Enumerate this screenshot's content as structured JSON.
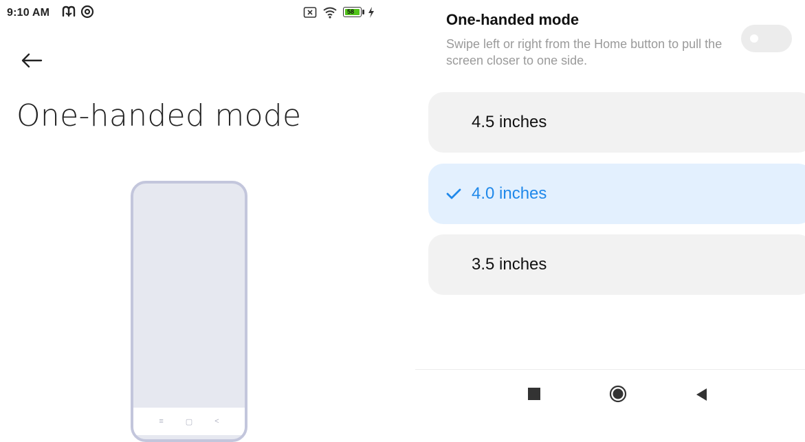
{
  "status_bar": {
    "time": "9:10 AM",
    "app_icons": [
      "m-app-icon",
      "at-sign-icon"
    ],
    "icons": [
      "sim-off-icon",
      "wifi-icon",
      "battery-icon",
      "charging-icon"
    ],
    "battery_level": "58",
    "battery_color": "#52c41a"
  },
  "header": {
    "back_icon": "arrow-left-icon",
    "title": "One-handed mode"
  },
  "preview": {
    "nav_icons": [
      "menu-icon",
      "home-square-icon",
      "back-chevron-icon"
    ],
    "nav_glyphs": [
      "≡",
      "▢",
      "<"
    ]
  },
  "setting": {
    "title": "One-handed mode",
    "description": "Swipe left or right from the Home button to pull the screen closer to one side.",
    "enabled": false
  },
  "options": [
    {
      "label": "4.5 inches",
      "selected": false
    },
    {
      "label": "4.0 inches",
      "selected": true
    },
    {
      "label": "3.5 inches",
      "selected": false
    }
  ],
  "colors": {
    "accent": "#1f88ea",
    "selected_bg": "#e3f0fe",
    "option_bg": "#f2f2f2",
    "frame": "#c3c6dc"
  },
  "nav_bar": {
    "icons": [
      "recents-square-icon",
      "home-circle-icon",
      "back-triangle-icon"
    ]
  }
}
